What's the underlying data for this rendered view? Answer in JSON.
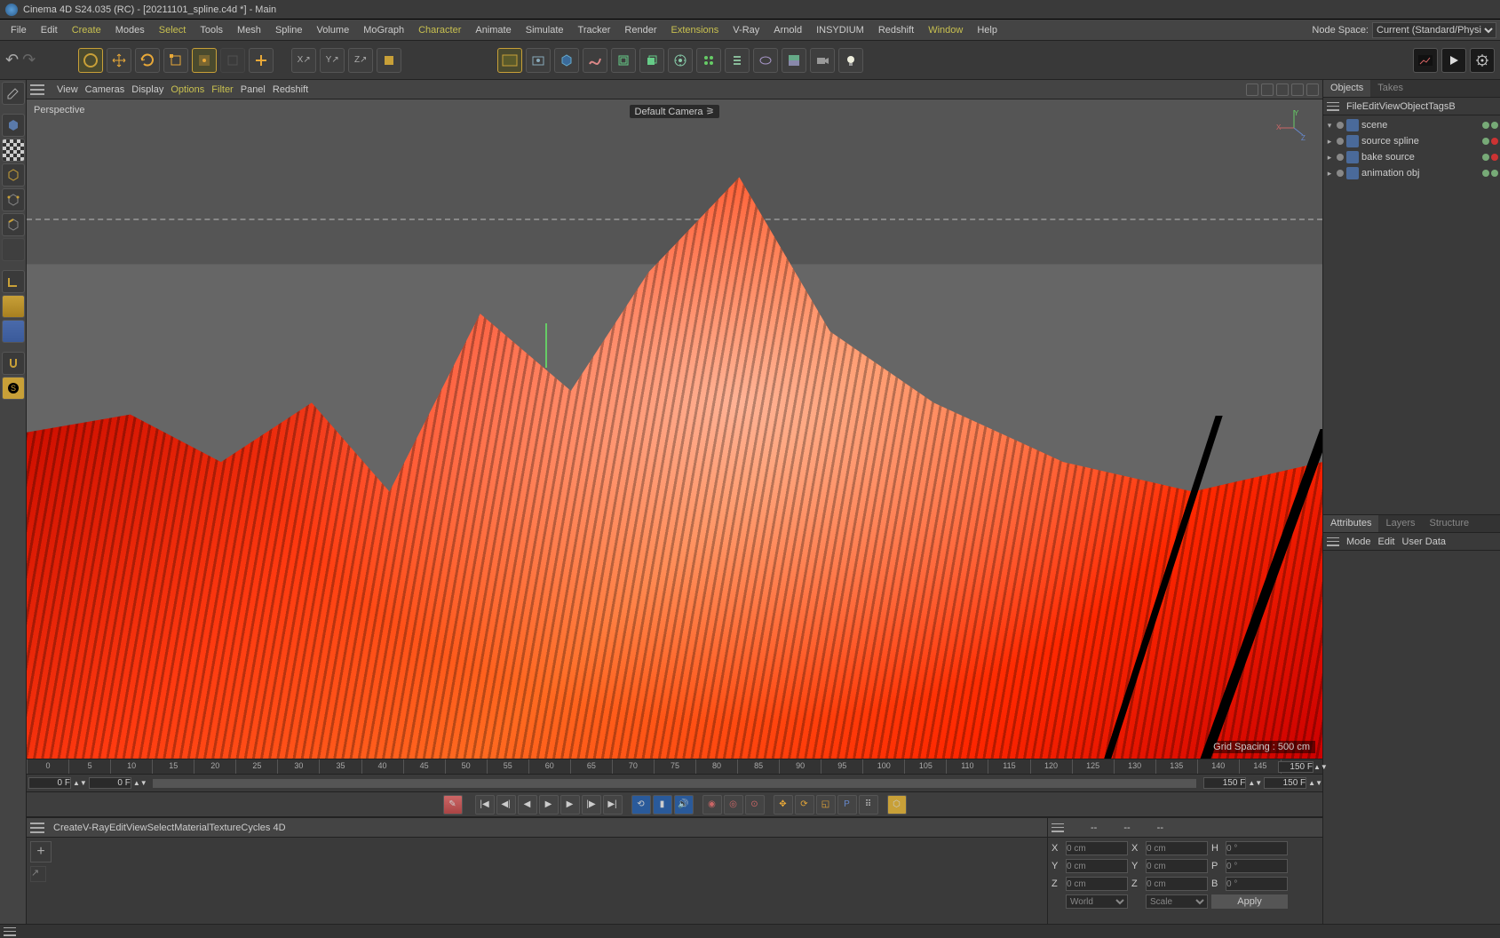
{
  "title": "Cinema 4D S24.035 (RC) - [20211101_spline.c4d *] - Main",
  "menu": [
    "File",
    "Edit",
    "Create",
    "Modes",
    "Select",
    "Tools",
    "Mesh",
    "Spline",
    "Volume",
    "MoGraph",
    "Character",
    "Animate",
    "Simulate",
    "Tracker",
    "Render",
    "Extensions",
    "V-Ray",
    "Arnold",
    "INSYDIUM",
    "Redshift",
    "Window",
    "Help"
  ],
  "menu_highlight": [
    "Create",
    "Select",
    "Character",
    "Extensions",
    "Window"
  ],
  "nodespace_label": "Node Space:",
  "nodespace_value": "Current (Standard/Physical)",
  "viewport_menu": [
    "View",
    "Cameras",
    "Display",
    "Options",
    "Filter",
    "Panel",
    "Redshift"
  ],
  "viewport_menu_highlight": [
    "Options",
    "Filter"
  ],
  "viewport_label": "Perspective",
  "viewport_camera": "Default Camera",
  "viewport_grid": "Grid Spacing : 500 cm",
  "axis": {
    "x": "X",
    "y": "Y",
    "z": "Z"
  },
  "timeline": {
    "ticks": [
      "0",
      "5",
      "10",
      "15",
      "20",
      "25",
      "30",
      "35",
      "40",
      "45",
      "50",
      "55",
      "60",
      "65",
      "70",
      "75",
      "80",
      "85",
      "90",
      "95",
      "100",
      "105",
      "110",
      "115",
      "120",
      "125",
      "130",
      "135",
      "140",
      "145",
      "150"
    ],
    "end_top": "150 F",
    "start_bottom": "0 F",
    "start_bottom2": "0 F",
    "end_bottom": "150 F",
    "end_bottom2": "150 F"
  },
  "material_menu": [
    "Create",
    "V-Ray",
    "Edit",
    "View",
    "Select",
    "Material",
    "Texture",
    "Cycles 4D"
  ],
  "coord": {
    "dash": "--",
    "labels": {
      "x": "X",
      "y": "Y",
      "z": "Z",
      "h": "H",
      "p": "P",
      "b": "B"
    },
    "pos": {
      "x": "0 cm",
      "y": "0 cm",
      "z": "0 cm"
    },
    "scl": {
      "x": "0 cm",
      "y": "0 cm",
      "z": "0 cm"
    },
    "rot": {
      "h": "0 °",
      "p": "0 °",
      "b": "0 °"
    },
    "mode1": "World",
    "mode2": "Scale",
    "apply": "Apply"
  },
  "objects_tabs": [
    "Objects",
    "Takes"
  ],
  "objects_menu": [
    "File",
    "Edit",
    "View",
    "Object",
    "Tags",
    "B"
  ],
  "tree": [
    {
      "name": "scene",
      "exp": "-",
      "dots": [
        "#7a7",
        "#7a7"
      ]
    },
    {
      "name": "source spline",
      "exp": "+",
      "dots": [
        "#7a7",
        "#c33"
      ]
    },
    {
      "name": "bake source",
      "exp": "+",
      "dots": [
        "#7a7",
        "#c33"
      ]
    },
    {
      "name": "animation obj",
      "exp": "+",
      "dots": [
        "#7a7",
        "#7a7"
      ]
    }
  ],
  "attr_tabs": [
    "Attributes",
    "Layers",
    "Structure"
  ],
  "attr_menu": [
    "Mode",
    "Edit",
    "User Data"
  ]
}
